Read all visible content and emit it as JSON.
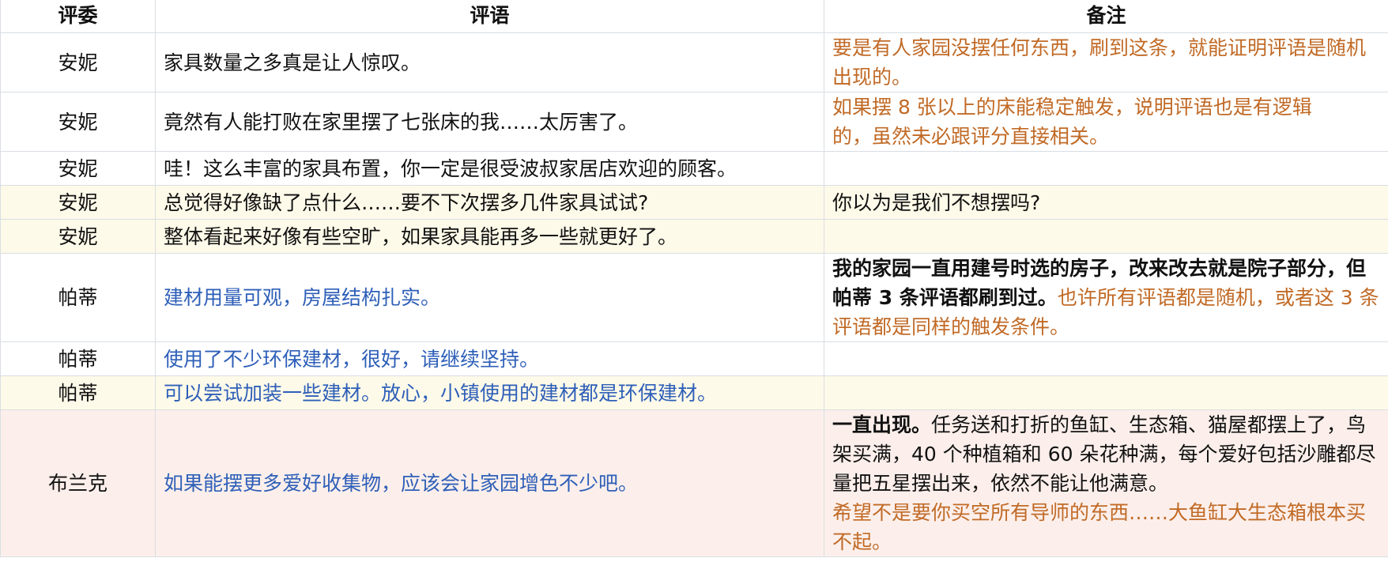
{
  "headers": [
    "评委",
    "评语",
    "备注"
  ],
  "colors": {
    "blue_text": "#2e5fb8",
    "orange_text": "#c16a26",
    "highlight_yellow": "#fefae9",
    "highlight_pink": "#fcefeb",
    "border": "#d9dee3"
  },
  "rows": [
    {
      "judge": "安妮",
      "comment": "家具数量之多真是让人惊叹。",
      "note_1": "要是有人家园没摆任何东西，刷到这条，就能证明评语是随机出现的。"
    },
    {
      "judge": "安妮",
      "comment": "竟然有人能打败在家里摆了七张床的我……太厉害了。",
      "note_1": "如果摆 8 张以上的床能稳定触发，说明评语也是有逻辑的，虽然未必跟评分直接相关。"
    },
    {
      "judge": "安妮",
      "comment": "哇！这么丰富的家具布置，你一定是很受波叔家居店欢迎的顾客。",
      "note_1": ""
    },
    {
      "judge": "安妮",
      "comment": "总觉得好像缺了点什么……要不下次摆多几件家具试试?",
      "note_1": "你以为是我们不想摆吗?"
    },
    {
      "judge": "安妮",
      "comment": "整体看起来好像有些空旷，如果家具能再多一些就更好了。",
      "note_1": ""
    },
    {
      "judge": "帕蒂",
      "comment": "建材用量可观，房屋结构扎实。",
      "note_1": "我的家园一直用建号时选的房子，改来改去就是院子部分，但帕蒂 3 条评语都刷到过。",
      "note_2": "也许所有评语都是随机，或者这 3 条评语都是同样的触发条件。"
    },
    {
      "judge": "帕蒂",
      "comment": "使用了不少环保建材，很好，请继续坚持。",
      "note_1": ""
    },
    {
      "judge": "帕蒂",
      "comment": "可以尝试加装一些建材。放心，小镇使用的建材都是环保建材。",
      "note_1": ""
    },
    {
      "judge": "布兰克",
      "comment": "如果能摆更多爱好收集物，应该会让家园增色不少吧。",
      "note_1": "一直出现。",
      "note_2": "任务送和打折的鱼缸、生态箱、猫屋都摆上了，鸟架买满，40 个种植箱和 60 朵花种满，每个爱好包括沙雕都尽量把五星摆出来，依然不能让他满意。",
      "note_3": "希望不是要你买空所有导师的东西……大鱼缸大生态箱根本买不起。"
    }
  ]
}
